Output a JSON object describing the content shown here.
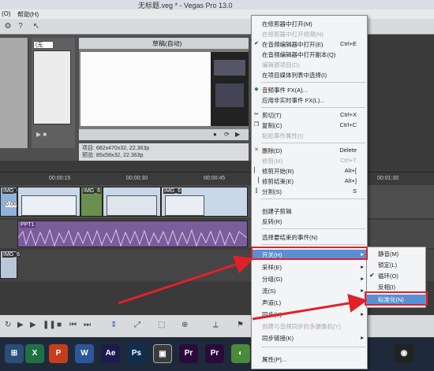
{
  "window": {
    "title": "无标题.veg * - Vegas Pro 13.0"
  },
  "menubar": {
    "items": [
      "(O)",
      "帮助(H)"
    ]
  },
  "trimmer": {
    "select_value": "(无"
  },
  "preview": {
    "mode_label": "草稿(自动)"
  },
  "info": {
    "project_line": "项目: 682x470x32, 22.363p",
    "preview_line": "预览: 85x58x32, 22.363p"
  },
  "ruler": {
    "ticks": [
      "00:00:15",
      "00:00:30",
      "00:00:45",
      "00:01:30"
    ]
  },
  "clips": {
    "video1": "IMG_6",
    "video2": "IMG_6",
    "video3": "IMG_6",
    "video_offset": "0.00",
    "audio": "PPT1",
    "track3": "IMG_6"
  },
  "context_menu": {
    "items": [
      {
        "label": "在修剪器中打开(M)",
        "shortcut": "",
        "disabled": false
      },
      {
        "label": "在修剪器中打开视频(N)",
        "shortcut": "",
        "disabled": true
      },
      {
        "label": "在音频编辑器中打开(E)",
        "shortcut": "Ctrl+E",
        "disabled": false
      },
      {
        "label": "在音频编辑器中打开副本(Q)",
        "shortcut": "",
        "disabled": false
      },
      {
        "label": "编辑源项目(D)",
        "shortcut": "",
        "disabled": true
      },
      {
        "label": "在项目媒体列表中选择(I)",
        "shortcut": "",
        "disabled": false
      },
      {
        "label": "音频事件 FX(A)...",
        "shortcut": "",
        "disabled": false
      },
      {
        "label": "应用非实时事件 FX(L)...",
        "shortcut": "",
        "disabled": false
      },
      {
        "label": "剪切(T)",
        "shortcut": "Ctrl+X",
        "disabled": false
      },
      {
        "label": "复制(C)",
        "shortcut": "Ctrl+C",
        "disabled": false
      },
      {
        "label": "粘贴事件属性(I)",
        "shortcut": "",
        "disabled": true
      },
      {
        "label": "删除(D)",
        "shortcut": "Delete",
        "disabled": false
      },
      {
        "label": "修剪(M)",
        "shortcut": "Ctrl+T",
        "disabled": true
      },
      {
        "label": "修剪开始(R)",
        "shortcut": "Alt+[",
        "disabled": false
      },
      {
        "label": "修剪结束(E)",
        "shortcut": "Alt+]",
        "disabled": false
      },
      {
        "label": "分割(S)",
        "shortcut": "S",
        "disabled": false
      },
      {
        "label": "创建子剪辑",
        "shortcut": "",
        "disabled": false
      },
      {
        "label": "反转(R)",
        "shortcut": "",
        "disabled": false
      },
      {
        "label": "选择要结束的事件(N)",
        "shortcut": "",
        "disabled": false
      },
      {
        "label": "开关(H)",
        "shortcut": "",
        "disabled": false,
        "highlight": true
      },
      {
        "label": "采样(E)",
        "shortcut": "",
        "disabled": false
      },
      {
        "label": "分组(G)",
        "shortcut": "",
        "disabled": false
      },
      {
        "label": "流(S)",
        "shortcut": "",
        "disabled": false
      },
      {
        "label": "声道(L)",
        "shortcut": "",
        "disabled": false
      },
      {
        "label": "同步(Y)",
        "shortcut": "",
        "disabled": false
      },
      {
        "label": "创建与音频同步的多摄像机(Y)",
        "shortcut": "",
        "disabled": true
      },
      {
        "label": "同步链接(K)",
        "shortcut": "",
        "disabled": false
      },
      {
        "label": "属性(P)...",
        "shortcut": "",
        "disabled": false
      }
    ]
  },
  "submenu": {
    "items": [
      {
        "label": "静音(M)",
        "checked": false
      },
      {
        "label": "锁定(L)",
        "checked": false
      },
      {
        "label": "循环(O)",
        "checked": true
      },
      {
        "label": "反相(I)",
        "checked": false
      },
      {
        "label": "标准化(N)",
        "checked": false,
        "highlight": true
      }
    ]
  },
  "taskbar": {
    "apps": [
      {
        "name": "excel",
        "glyph": "X",
        "color": "#1e7145"
      },
      {
        "name": "powerpoint",
        "glyph": "P",
        "color": "#c43e1c"
      },
      {
        "name": "word",
        "glyph": "W",
        "color": "#2b579a"
      },
      {
        "name": "after-effects",
        "glyph": "Ae",
        "color": "#1f1a4d"
      },
      {
        "name": "photoshop",
        "glyph": "Ps",
        "color": "#0c2f4d"
      },
      {
        "name": "photoshop-2",
        "glyph": "Ps",
        "color": "#0c2f4d"
      },
      {
        "name": "vegas",
        "glyph": "▣",
        "color": "#3b3b3b"
      },
      {
        "name": "premiere",
        "glyph": "Pr",
        "color": "#2a0a3d"
      },
      {
        "name": "premiere-2",
        "glyph": "Pr",
        "color": "#2a0a3d"
      }
    ]
  }
}
